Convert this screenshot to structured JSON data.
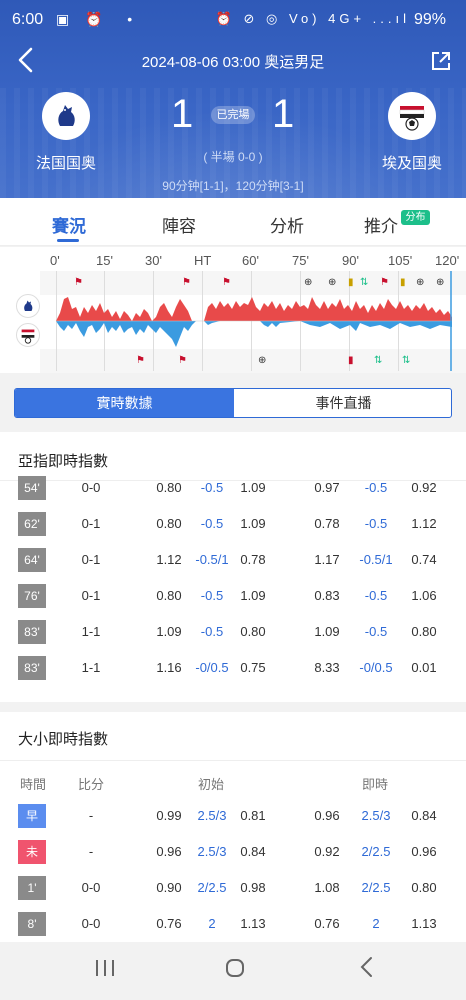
{
  "statusbar": {
    "time": "6:00",
    "left_icons": "▣ ⏰  •",
    "right_icons": "⏰ ⊘ ◎ Vo) 4G+ ...ıl",
    "battery": "99%"
  },
  "header": {
    "title": "2024-08-06 03:00 奥运男足",
    "home_team": "法国国奥",
    "away_team": "埃及国奥",
    "home_score": "1",
    "away_score": "1",
    "status": "已完場",
    "halftime": "( 半場 0-0 )",
    "extra": "90分钟[1-1]，120分钟[3-1]"
  },
  "tabs": [
    {
      "label": "賽況",
      "active": true
    },
    {
      "label": "陣容",
      "active": false
    },
    {
      "label": "分析",
      "active": false
    },
    {
      "label": "推介",
      "active": false
    }
  ],
  "tab_badge": "分布",
  "timeline": {
    "labels": [
      "0'",
      "15'",
      "30'",
      "HT",
      "60'",
      "75'",
      "90'",
      "105'",
      "120'"
    ]
  },
  "segment": {
    "active": "實時數據",
    "inactive": "事件直播"
  },
  "asian": {
    "title": "亞指即時指數",
    "rows": [
      {
        "min": "54'",
        "score": "0-0",
        "a": "0.80",
        "b": "-0.5",
        "c": "1.09",
        "d": "0.97",
        "e": "-0.5",
        "f": "0.92"
      },
      {
        "min": "62'",
        "score": "0-1",
        "a": "0.80",
        "b": "-0.5",
        "c": "1.09",
        "d": "0.78",
        "e": "-0.5",
        "f": "1.12"
      },
      {
        "min": "64'",
        "score": "0-1",
        "a": "1.12",
        "b": "-0.5/1",
        "c": "0.78",
        "d": "1.17",
        "e": "-0.5/1",
        "f": "0.74"
      },
      {
        "min": "76'",
        "score": "0-1",
        "a": "0.80",
        "b": "-0.5",
        "c": "1.09",
        "d": "0.83",
        "e": "-0.5",
        "f": "1.06"
      },
      {
        "min": "83'",
        "score": "1-1",
        "a": "1.09",
        "b": "-0.5",
        "c": "0.80",
        "d": "1.09",
        "e": "-0.5",
        "f": "0.80"
      },
      {
        "min": "83'",
        "score": "1-1",
        "a": "1.16",
        "b": "-0/0.5",
        "c": "0.75",
        "d": "8.33",
        "e": "-0/0.5",
        "f": "0.01"
      }
    ]
  },
  "overunder": {
    "title": "大小即時指數",
    "headers": {
      "time": "時間",
      "score": "比分",
      "initial": "初始",
      "live": "即時"
    },
    "rows": [
      {
        "min": "早",
        "color": "#5b8def",
        "score": "-",
        "a": "0.99",
        "b": "2.5/3",
        "c": "0.81",
        "d": "0.96",
        "e": "2.5/3",
        "f": "0.84"
      },
      {
        "min": "未",
        "color": "#f0546e",
        "score": "-",
        "a": "0.96",
        "b": "2.5/3",
        "c": "0.84",
        "d": "0.92",
        "e": "2/2.5",
        "f": "0.96"
      },
      {
        "min": "1'",
        "color": "#8a8a8a",
        "score": "0-0",
        "a": "0.90",
        "b": "2/2.5",
        "c": "0.98",
        "d": "1.08",
        "e": "2/2.5",
        "f": "0.80"
      },
      {
        "min": "8'",
        "color": "#8a8a8a",
        "score": "0-0",
        "a": "0.76",
        "b": "2",
        "c": "1.13",
        "d": "0.76",
        "e": "2",
        "f": "1.13"
      }
    ]
  },
  "colors": {
    "accent": "#2f6ad6",
    "header": "#3a66c6",
    "home_bar": "#e84a4a",
    "away_bar": "#3b9be0"
  }
}
